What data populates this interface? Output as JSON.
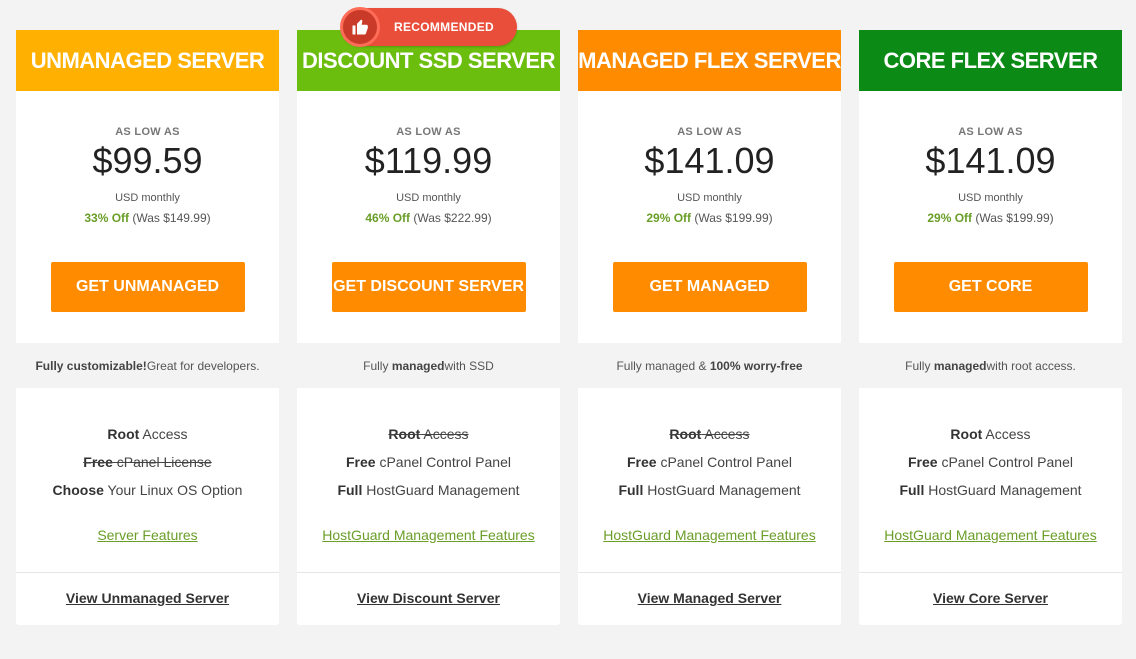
{
  "badge": {
    "label": "RECOMMENDED",
    "icon": "thumbs-up-icon"
  },
  "colors": {
    "unmanaged": "#ffb000",
    "discount": "#6bbd0e",
    "managed": "#ff8c00",
    "core": "#0b8a16",
    "cta": "#ff8c00",
    "discount_text": "#6a9e28"
  },
  "plans": [
    {
      "title": "UNMANAGED SERVER",
      "as_low_as": "AS LOW AS",
      "price": "$99.59",
      "period": "USD monthly",
      "off": "33% Off",
      "was": "(Was $149.99)",
      "cta": "GET UNMANAGED",
      "tagline_a": "Fully customizable!",
      "tagline_b": " Great for developers.",
      "features": [
        {
          "bold": "Root",
          "text": " Access",
          "struck": false
        },
        {
          "bold": "Free",
          "text": " cPanel License",
          "struck": true
        },
        {
          "bold": "Choose",
          "text": " Your Linux OS Option",
          "struck": false
        }
      ],
      "feature_link": "Server Features",
      "view_link": "View Unmanaged Server"
    },
    {
      "title": "DISCOUNT SSD SERVER",
      "as_low_as": "AS LOW AS",
      "price": "$119.99",
      "period": "USD monthly",
      "off": "46% Off",
      "was": "(Was $222.99)",
      "cta": "GET DISCOUNT SERVER",
      "tagline_a": "Fully ",
      "tagline_b": "managed",
      "tagline_c": " with SSD",
      "features": [
        {
          "bold": "Root",
          "text": " Access",
          "struck": true
        },
        {
          "bold": "Free",
          "text": " cPanel Control Panel",
          "struck": false
        },
        {
          "bold": "Full",
          "text": " HostGuard Management",
          "struck": false
        }
      ],
      "feature_link": "HostGuard Management Features",
      "view_link": "View Discount Server"
    },
    {
      "title": "MANAGED FLEX SERVER",
      "as_low_as": "AS LOW AS",
      "price": "$141.09",
      "period": "USD monthly",
      "off": "29% Off",
      "was": "(Was $199.99)",
      "cta": "GET MANAGED",
      "tagline_a": "Fully managed & ",
      "tagline_b": "100% worry-free",
      "features": [
        {
          "bold": "Root",
          "text": " Access",
          "struck": true
        },
        {
          "bold": "Free",
          "text": " cPanel Control Panel",
          "struck": false
        },
        {
          "bold": "Full",
          "text": " HostGuard Management",
          "struck": false
        }
      ],
      "feature_link": "HostGuard Management Features",
      "view_link": "View Managed Server"
    },
    {
      "title": "CORE FLEX SERVER",
      "as_low_as": "AS LOW AS",
      "price": "$141.09",
      "period": "USD monthly",
      "off": "29% Off",
      "was": "(Was $199.99)",
      "cta": "GET CORE",
      "tagline_a": "Fully ",
      "tagline_b": "managed",
      "tagline_c": " with root access.",
      "features": [
        {
          "bold": "Root",
          "text": " Access",
          "struck": false
        },
        {
          "bold": "Free",
          "text": " cPanel Control Panel",
          "struck": false
        },
        {
          "bold": "Full",
          "text": " HostGuard Management",
          "struck": false
        }
      ],
      "feature_link": "HostGuard Management Features",
      "view_link": "View Core Server"
    }
  ]
}
